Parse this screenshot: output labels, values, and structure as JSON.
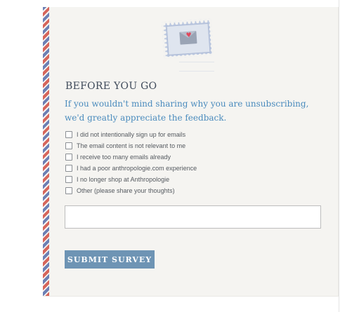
{
  "survey": {
    "title": "BEFORE YOU GO",
    "subtitle": "If you wouldn't mind sharing why you are unsubscribing, we'd greatly appreciate the feedback.",
    "options": [
      {
        "label": "I did not intentionally sign up for emails",
        "checked": false
      },
      {
        "label": "The email content is not relevant to me",
        "checked": false
      },
      {
        "label": "I receive too many emails already",
        "checked": false
      },
      {
        "label": "I had a poor anthropologie.com experience",
        "checked": false
      },
      {
        "label": "I no longer shop at Anthropologie",
        "checked": false
      },
      {
        "label": "Other (please share your thoughts)",
        "checked": false
      }
    ],
    "feedback_value": "",
    "submit_label": "SUBMIT SURVEY"
  },
  "stamp": {
    "icon": "envelope-heart-icon",
    "heart_glyph": "♥"
  },
  "colors": {
    "airmail_red": "#d6655b",
    "airmail_blue": "#6c7fb4",
    "title": "#3f4a5a",
    "subtitle": "#4a8bbd",
    "button": "#6e94b4",
    "card_background": "#f5f4f1"
  }
}
